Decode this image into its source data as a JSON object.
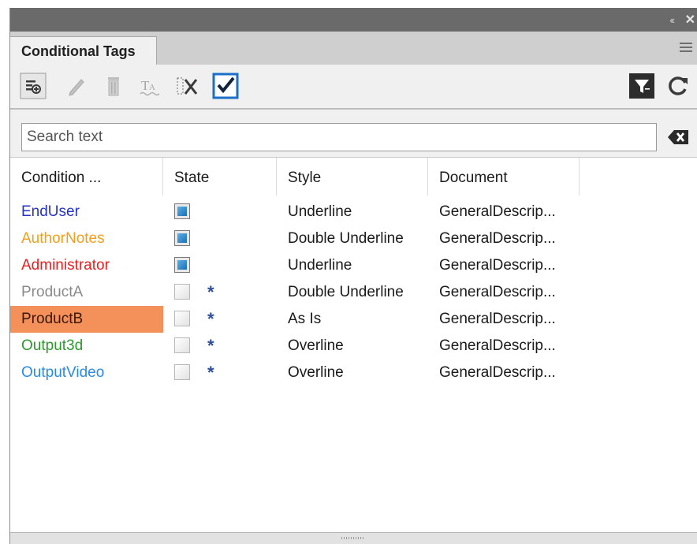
{
  "window": {
    "collapse_glyph": "‹‹",
    "close_glyph": "✕"
  },
  "tab": {
    "title": "Conditional Tags"
  },
  "toolbar": {
    "icons": [
      "new-condition-icon",
      "edit-icon",
      "delete-icon",
      "apply-tag-icon",
      "remove-tag-icon",
      "show-hide-toggle-icon",
      "filter-icon",
      "refresh-icon"
    ]
  },
  "search": {
    "placeholder": "Search text",
    "value": ""
  },
  "table": {
    "columns": [
      "Condition ...",
      "State",
      "Style",
      "Document"
    ],
    "rows": [
      {
        "name": "EndUser",
        "color": "#2432c8",
        "state": "on",
        "indicator": "",
        "style": "Underline",
        "document": "GeneralDescrip..."
      },
      {
        "name": "AuthorNotes",
        "color": "#f0a020",
        "state": "on",
        "indicator": "",
        "style": "Double Underline",
        "document": "GeneralDescrip..."
      },
      {
        "name": "Administrator",
        "color": "#e82020",
        "state": "on",
        "indicator": "",
        "style": "Underline",
        "document": "GeneralDescrip..."
      },
      {
        "name": "ProductA",
        "color": "#8a8a8a",
        "state": "off",
        "indicator": "*",
        "style": "Double Underline",
        "document": "GeneralDescrip..."
      },
      {
        "name": "ProductB",
        "color": "#3a1808",
        "state": "off",
        "indicator": "*",
        "style": "As Is",
        "document": "GeneralDescrip...",
        "selected": true
      },
      {
        "name": "Output3d",
        "color": "#2c9a2c",
        "state": "off",
        "indicator": "*",
        "style": "Overline",
        "document": "GeneralDescrip..."
      },
      {
        "name": "OutputVideo",
        "color": "#2a8ae8",
        "state": "off",
        "indicator": "*",
        "style": "Overline",
        "document": "GeneralDescrip..."
      }
    ]
  },
  "colors": {
    "selection": "#f4905a",
    "checkbox_on": "#1c6fb5",
    "toolbar_check": "#1a6fc8"
  }
}
